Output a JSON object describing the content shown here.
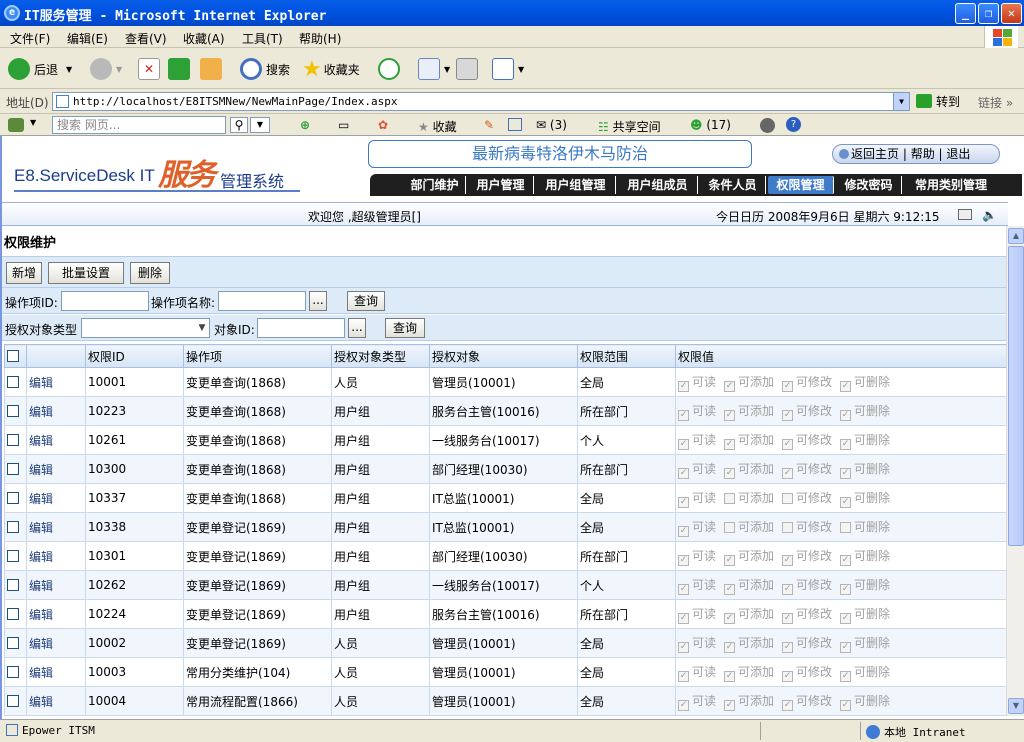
{
  "window": {
    "title": "IT服务管理 - Microsoft Internet Explorer"
  },
  "menu": [
    "文件(F)",
    "编辑(E)",
    "查看(V)",
    "收藏(A)",
    "工具(T)",
    "帮助(H)"
  ],
  "toolbar": {
    "back": "后退",
    "search": "搜索",
    "favorites": "收藏夹"
  },
  "address": {
    "label": "地址(D)",
    "url": "http://localhost/E8ITSMNew/NewMainPage/Index.aspx",
    "go": "转到",
    "links": "链接"
  },
  "linksbar": {
    "search_placeholder": "搜索 网页...",
    "favorites": "收藏",
    "mail_count": "(3)",
    "share": "共享空间",
    "friends_count": "(17)"
  },
  "header": {
    "logo_prefix": "E8.ServiceDesk IT",
    "logo_art": "服务",
    "logo_suffix": "管理系统",
    "banner": "最新病毒特洛伊木马防治",
    "top_links": [
      "返回主页",
      "帮助",
      "退出"
    ],
    "nav": [
      "部门维护",
      "用户管理",
      "用户组管理",
      "用户组成员",
      "条件人员",
      "权限管理",
      "修改密码",
      "常用类别管理"
    ],
    "nav_active": 5
  },
  "info": {
    "welcome": "欢迎您 ,超级管理员[]",
    "date": "今日日历 2008年9月6日 星期六 9:12:15"
  },
  "page": {
    "title": "权限维护",
    "buttons": [
      "新增",
      "批量设置",
      "删除"
    ],
    "filter1": {
      "id_label": "操作项ID:",
      "name_label": "操作项名称:",
      "dots": "...",
      "query": "查询"
    },
    "filter2": {
      "type_label": "授权对象类型",
      "obj_label": "对象ID:",
      "dots": "...",
      "query": "查询"
    }
  },
  "table": {
    "columns": [
      "",
      "",
      "权限ID",
      "操作项",
      "授权对象类型",
      "授权对象",
      "权限范围",
      "权限值"
    ],
    "edit_label": "编辑",
    "perm_labels": [
      "可读",
      "可添加",
      "可修改",
      "可删除"
    ],
    "rows": [
      {
        "id": "10001",
        "op": "变更单查询(1868)",
        "type": "人员",
        "obj": "管理员(10001)",
        "scope": "全局",
        "perms": [
          1,
          1,
          1,
          1
        ]
      },
      {
        "id": "10223",
        "op": "变更单查询(1868)",
        "type": "用户组",
        "obj": "服务台主管(10016)",
        "scope": "所在部门",
        "perms": [
          1,
          1,
          1,
          1
        ]
      },
      {
        "id": "10261",
        "op": "变更单查询(1868)",
        "type": "用户组",
        "obj": "一线服务台(10017)",
        "scope": "个人",
        "perms": [
          1,
          1,
          1,
          1
        ]
      },
      {
        "id": "10300",
        "op": "变更单查询(1868)",
        "type": "用户组",
        "obj": "部门经理(10030)",
        "scope": "所在部门",
        "perms": [
          1,
          1,
          1,
          1
        ]
      },
      {
        "id": "10337",
        "op": "变更单查询(1868)",
        "type": "用户组",
        "obj": "IT总监(10001)",
        "scope": "全局",
        "perms": [
          1,
          0,
          0,
          1
        ]
      },
      {
        "id": "10338",
        "op": "变更单登记(1869)",
        "type": "用户组",
        "obj": "IT总监(10001)",
        "scope": "全局",
        "perms": [
          1,
          0,
          0,
          0
        ]
      },
      {
        "id": "10301",
        "op": "变更单登记(1869)",
        "type": "用户组",
        "obj": "部门经理(10030)",
        "scope": "所在部门",
        "perms": [
          1,
          1,
          1,
          1
        ]
      },
      {
        "id": "10262",
        "op": "变更单登记(1869)",
        "type": "用户组",
        "obj": "一线服务台(10017)",
        "scope": "个人",
        "perms": [
          1,
          1,
          1,
          1
        ]
      },
      {
        "id": "10224",
        "op": "变更单登记(1869)",
        "type": "用户组",
        "obj": "服务台主管(10016)",
        "scope": "所在部门",
        "perms": [
          1,
          1,
          1,
          1
        ]
      },
      {
        "id": "10002",
        "op": "变更单登记(1869)",
        "type": "人员",
        "obj": "管理员(10001)",
        "scope": "全局",
        "perms": [
          1,
          1,
          1,
          1
        ]
      },
      {
        "id": "10003",
        "op": "常用分类维护(104)",
        "type": "人员",
        "obj": "管理员(10001)",
        "scope": "全局",
        "perms": [
          1,
          1,
          1,
          1
        ]
      },
      {
        "id": "10004",
        "op": "常用流程配置(1866)",
        "type": "人员",
        "obj": "管理员(10001)",
        "scope": "全局",
        "perms": [
          1,
          1,
          1,
          1
        ]
      }
    ]
  },
  "status": {
    "left": "Epower ITSM",
    "zone": "本地 Intranet"
  }
}
